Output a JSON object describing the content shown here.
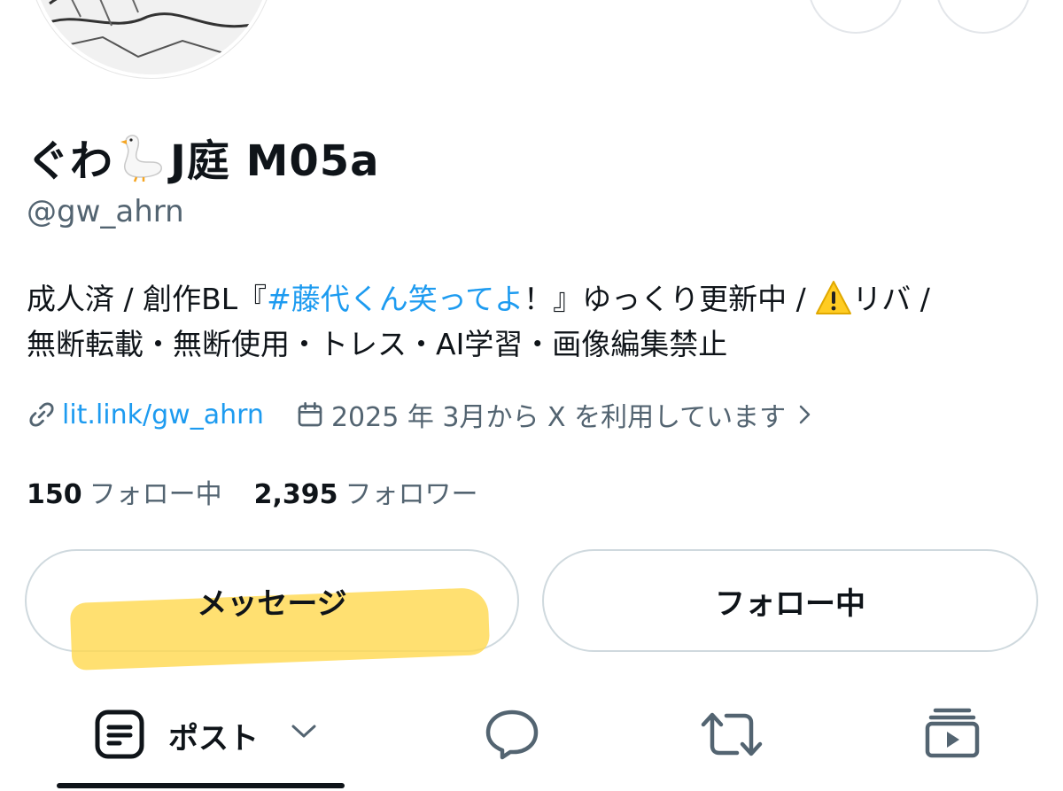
{
  "profile": {
    "name_prefix": "ぐわ",
    "name_suffix": "J庭 M05a",
    "name_emoji_icon": "goose-icon",
    "handle": "@gw_ahrn"
  },
  "bio": {
    "part1": "成人済 / 創作BL『",
    "hashtag": "#藤代くん笑ってよ",
    "part2": "！』ゆっくり更新中 / ",
    "warning_icon": "warning-icon",
    "part3": "リバ /",
    "line2": "無断転載・無断使用・トレス・AI学習・画像編集禁止"
  },
  "meta": {
    "link_icon": "link-icon",
    "link_text": "lit.link/gw_ahrn",
    "calendar_icon": "calendar-icon",
    "joined_text": "2025 年 3月から X を利用しています",
    "chevron_icon": "chevron-right-icon"
  },
  "stats": {
    "following_count": "150",
    "following_label": "フォロー中",
    "followers_count": "2,395",
    "followers_label": "フォロワー"
  },
  "actions": {
    "message_label": "メッセージ",
    "following_button_label": "フォロー中"
  },
  "tabs": {
    "posts_label": "ポスト",
    "icons": [
      "posts-icon",
      "chevron-down-icon",
      "reply-icon",
      "repost-icon",
      "media-icon"
    ]
  },
  "colors": {
    "link": "#1d9bf0",
    "secondary_text": "#536471",
    "highlight": "#ffd84d"
  }
}
